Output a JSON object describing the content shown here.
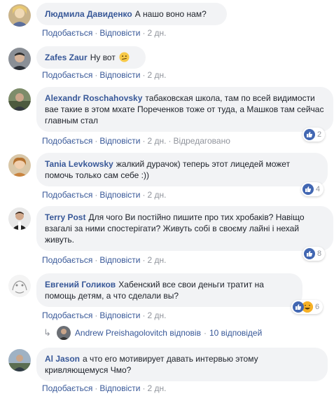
{
  "action_labels": {
    "like": "Подобається",
    "reply": "Відповісти",
    "dot": "·"
  },
  "comments": [
    {
      "author": "Людмила Давиденко",
      "text": "А нашо воно нам?",
      "time": "2 дн."
    },
    {
      "author": "Zafes Zaur",
      "text": "Ну вот",
      "emoji": "confused-face-emoji",
      "time": "2 дн."
    },
    {
      "author": "Alexandr Roschahovsky",
      "text": "табаковская школа, там по всей видимости вае такие в этом мхате Пореченков тоже от туда, а Машков там сейчас главным стал",
      "time": "2 дн.",
      "edited": "Відредаговано",
      "reactions": "2"
    },
    {
      "author": "Tania Levkowsky",
      "text": "жалкий дурачок) теперь этот лицедей может помочь только сам себе :))",
      "time": "2 дн.",
      "reactions": "4"
    },
    {
      "author": "Terry Post",
      "text": "Для чого Ви постійно пишите про тих хробаків? Навіщо взагалі за ними спостерігати? Живуть собі в своєму лайні і нехай живуть.",
      "time": "2 дн.",
      "reactions": "8"
    },
    {
      "author": "Евгений Голиков",
      "text": "Хабенский все свои деньги тратит на помощь детям, а что сделали вы?",
      "time": "2 дн.",
      "reactions": "6"
    },
    {
      "author": "Al Jason",
      "text": "а что его мотивирует давать интервью этому кривляющемуся Чмо?",
      "time": "2 дн."
    }
  ],
  "replies_row": {
    "arrow": "↳",
    "author": "Andrew Preishagolovitch",
    "action": "відповів",
    "count": "10 відповідей"
  },
  "colors": {
    "link": "#385898",
    "meta": "#90949c",
    "bubble": "#f2f3f5",
    "like": "#4267b2",
    "haha": "#f7b125"
  }
}
